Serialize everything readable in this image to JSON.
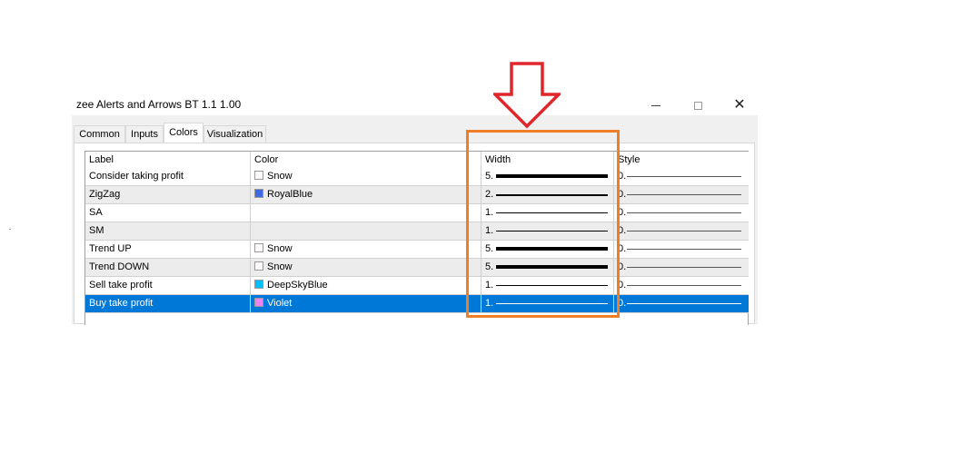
{
  "window": {
    "title": "zee Alerts and Arrows BT 1.1 1.00",
    "close_glyph": "✕"
  },
  "tabs": [
    {
      "label": "Common",
      "active": false
    },
    {
      "label": "Inputs",
      "active": false
    },
    {
      "label": "Colors",
      "active": true
    },
    {
      "label": "Visualization",
      "active": false
    }
  ],
  "table": {
    "headers": {
      "label": "Label",
      "color": "Color",
      "width": "Width",
      "style": "Style"
    },
    "rows": [
      {
        "label": "Consider taking profit",
        "color_name": "Snow",
        "swatch": "#fffafa",
        "width": "5.",
        "width_value": 5,
        "style": "0.",
        "selected": false
      },
      {
        "label": "ZigZag",
        "color_name": "RoyalBlue",
        "swatch": "#4169e1",
        "width": "2.",
        "width_value": 2,
        "style": "0.",
        "selected": false
      },
      {
        "label": "SA",
        "color_name": "",
        "swatch": "",
        "width": "1.",
        "width_value": 1,
        "style": "0.",
        "selected": false
      },
      {
        "label": "SM",
        "color_name": "",
        "swatch": "",
        "width": "1.",
        "width_value": 1,
        "style": "0.",
        "selected": false
      },
      {
        "label": "Trend UP",
        "color_name": "Snow",
        "swatch": "#fffafa",
        "width": "5.",
        "width_value": 5,
        "style": "0.",
        "selected": false
      },
      {
        "label": "Trend DOWN",
        "color_name": "Snow",
        "swatch": "#fffafa",
        "width": "5.",
        "width_value": 5,
        "style": "0.",
        "selected": false
      },
      {
        "label": "Sell take profit",
        "color_name": "DeepSkyBlue",
        "swatch": "#00bfff",
        "width": "1.",
        "width_value": 1,
        "style": "0.",
        "selected": false
      },
      {
        "label": "Buy take profit",
        "color_name": "Violet",
        "swatch": "#ee82ee",
        "width": "1.",
        "width_value": 1,
        "style": "0.",
        "selected": true
      }
    ]
  },
  "annotation": {
    "arrow_color": "#e0262b",
    "highlight_color": "#f07e26"
  },
  "colors": {
    "selection": "#0078d7",
    "row_alt": "#ececec"
  }
}
